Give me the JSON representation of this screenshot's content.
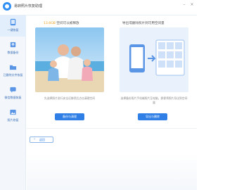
{
  "app": {
    "title": "易转照片恢复助理"
  },
  "window": {
    "minimize_icon": "minimize-icon",
    "close_icon": "close-icon"
  },
  "sidebar": {
    "items": [
      {
        "label": "一键恢复",
        "icon": "device-icon",
        "active": true
      },
      {
        "label": "数据备份",
        "icon": "backup-icon",
        "active": false
      },
      {
        "label": "已删除文件恢复",
        "icon": "folder-icon",
        "active": false
      },
      {
        "label": "微信数据恢复",
        "icon": "chat-icon",
        "active": false
      },
      {
        "label": "照片修复",
        "icon": "photo-icon",
        "active": false
      }
    ]
  },
  "cards": {
    "left": {
      "title_highlight": "13.6GB",
      "title_rest": " 空间可以被释放",
      "description": "先选择照片进行安全迁移然后点击清理空间",
      "button": "备份与清理"
    },
    "right": {
      "title": "导出或删除照片到可用空间量",
      "description": "选择备份照片手机端照片至电脑，即便将照片导出到空间量",
      "button": "导出与删除"
    }
  },
  "footer": {
    "back_label": "返回"
  },
  "colors": {
    "accent": "#2f7fe6",
    "highlight": "#f29b12",
    "sidebar_bg": "#f3f7fc"
  }
}
